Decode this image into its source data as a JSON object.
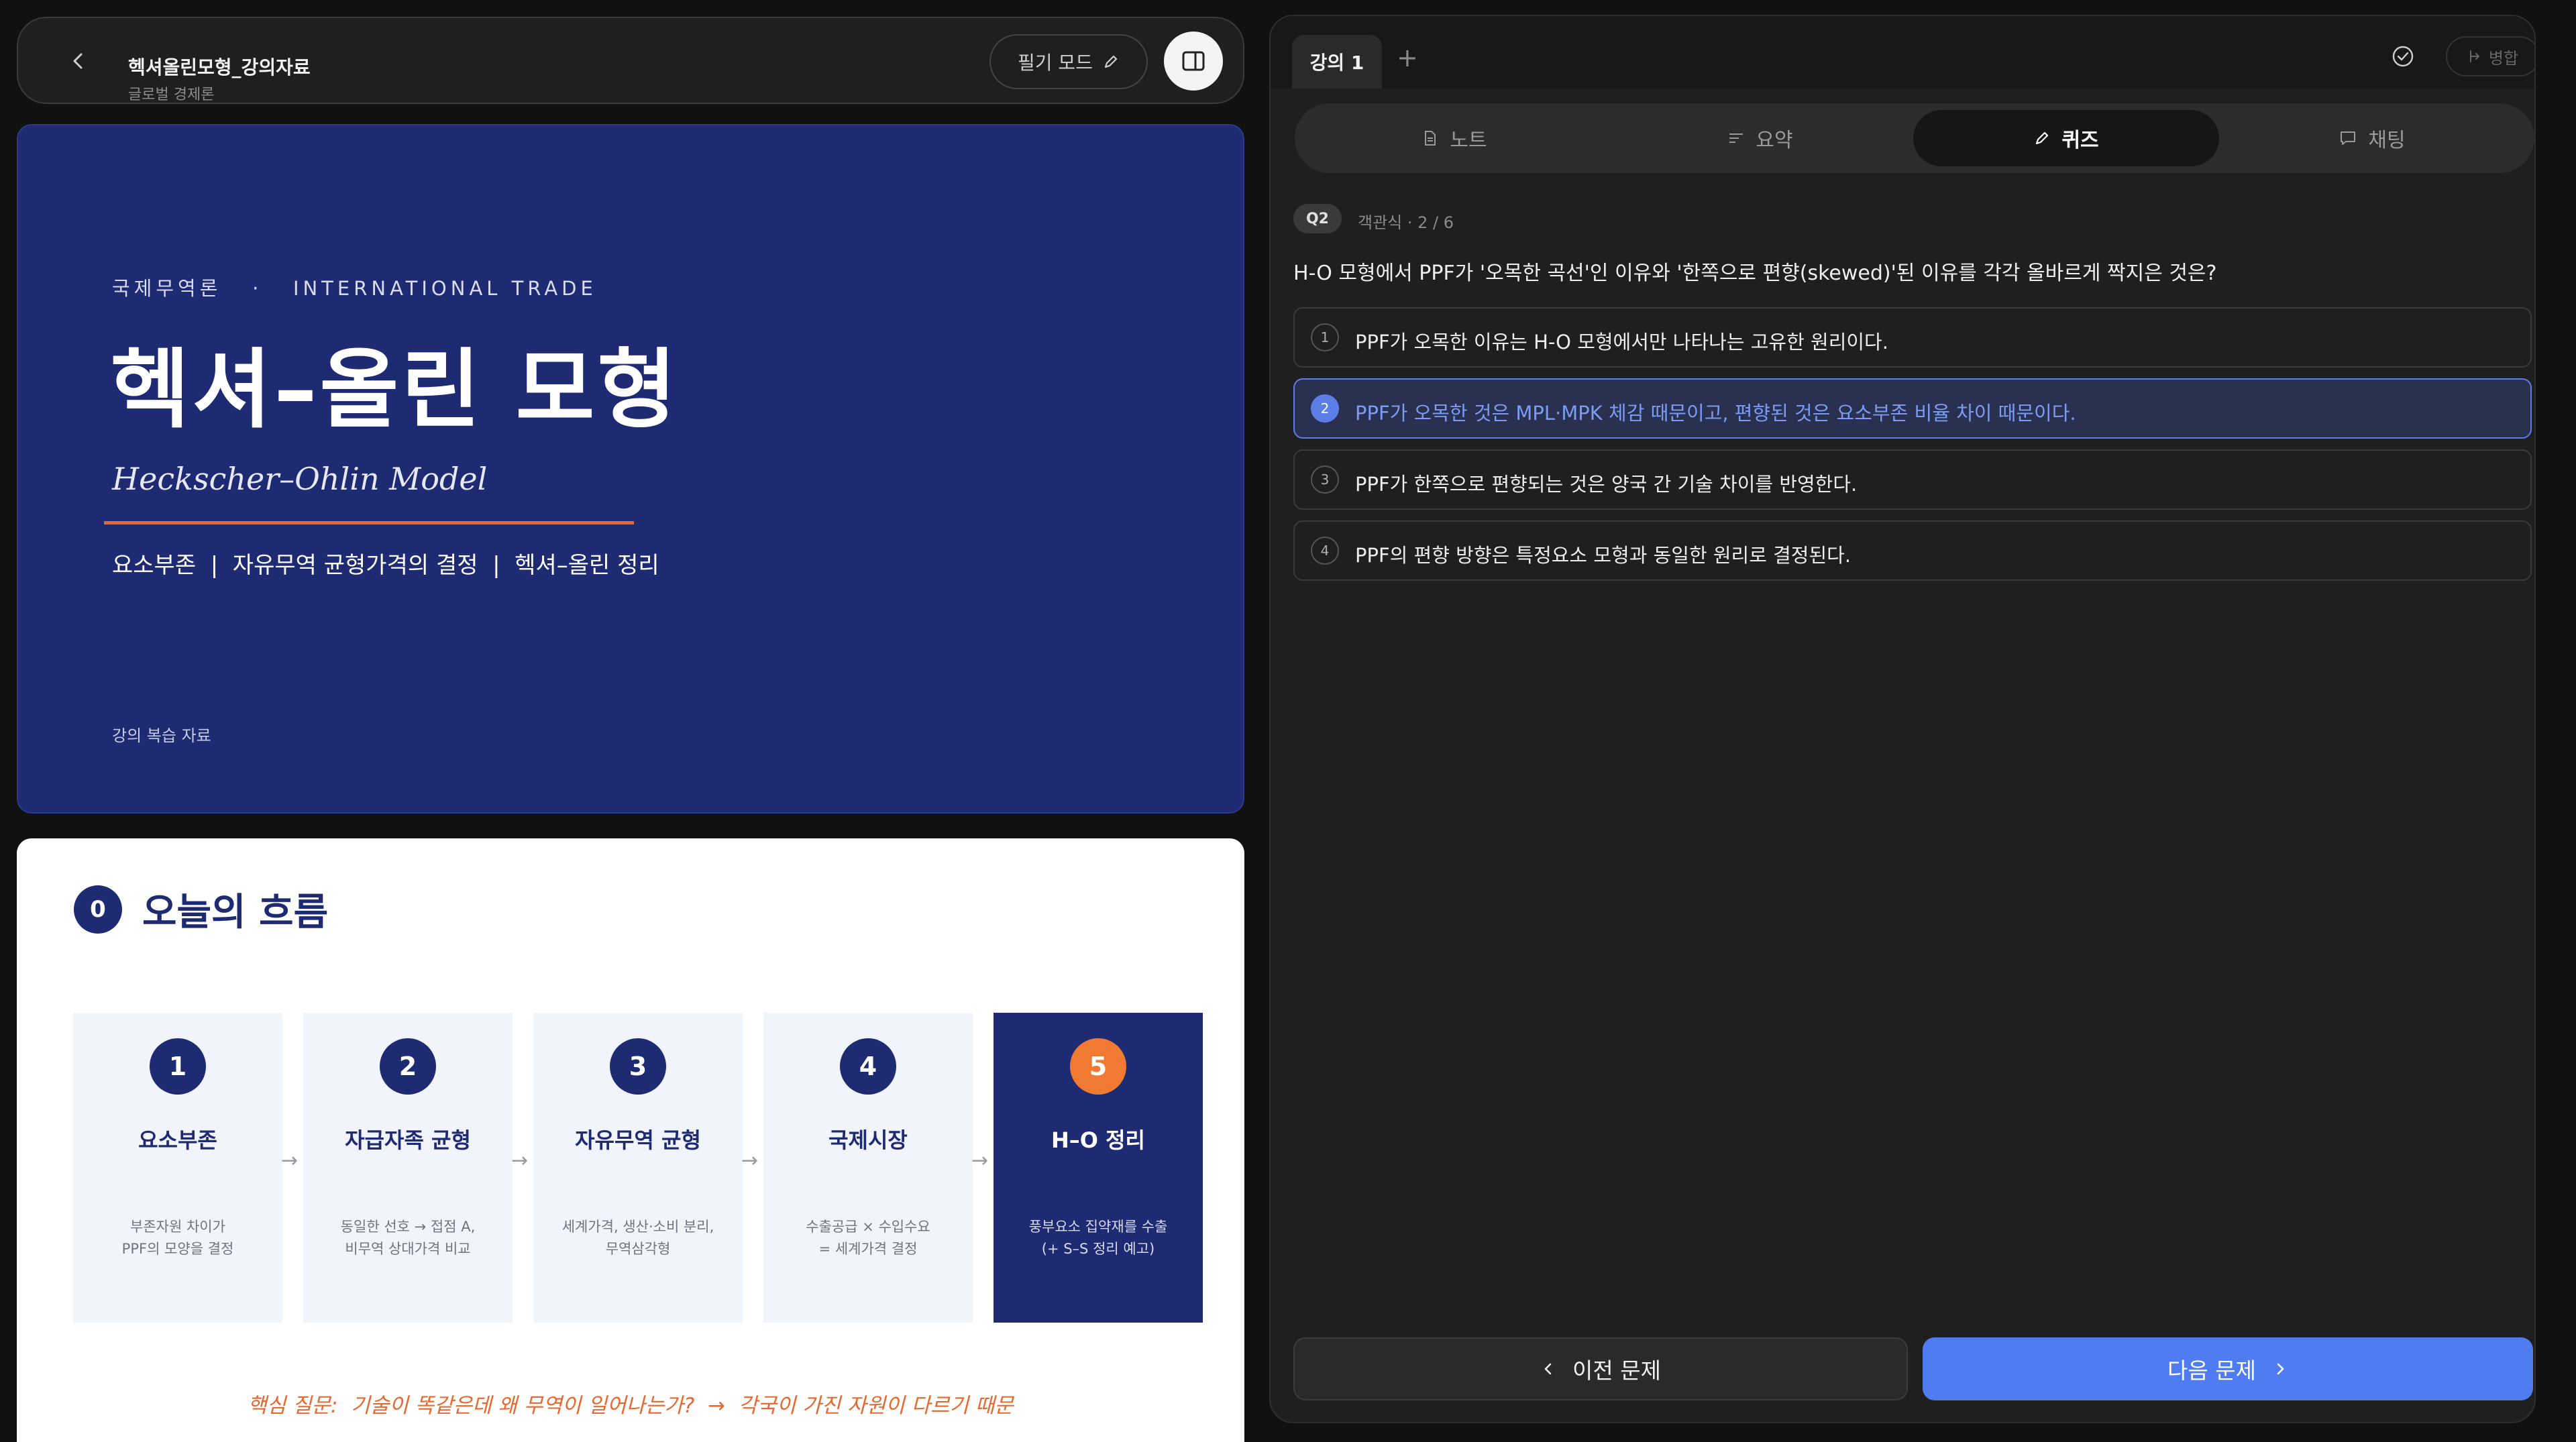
{
  "header": {
    "title": "헥셔올린모형_강의자료",
    "subtitle": "글로벌 경제론",
    "pen_mode_label": "필기 모드"
  },
  "title_slide": {
    "kicker_ko": "국제무역론",
    "kicker_sep": "·",
    "kicker_en": "INTERNATIONAL TRADE",
    "title": "헥셔–올린 모형",
    "english_title": "Heckscher–Ohlin Model",
    "topics": "요소부존  |  자유무역 균형가격의 결정  |  헥셔–올린 정리",
    "footer": "강의 복습 자료"
  },
  "flow_slide": {
    "section_number": "0",
    "title": "오늘의 흐름",
    "steps": [
      {
        "num": "1",
        "title": "요소부존",
        "desc1": "부존자원 차이가",
        "desc2": "PPF의 모양을 결정"
      },
      {
        "num": "2",
        "title": "자급자족 균형",
        "desc1": "동일한 선호 → 접점 A,",
        "desc2": "비무역 상대가격 비교"
      },
      {
        "num": "3",
        "title": "자유무역 균형",
        "desc1": "세계가격, 생산·소비 분리,",
        "desc2": "무역삼각형"
      },
      {
        "num": "4",
        "title": "국제시장",
        "desc1": "수출공급 × 수입수요",
        "desc2": "= 세계가격 결정"
      },
      {
        "num": "5",
        "title": "H–O 정리",
        "desc1": "풍부요소 집약재를 수출",
        "desc2": "(+ S–S 정리 예고)"
      }
    ],
    "arrow": "→",
    "key_question": "핵심 질문:  기술이 똑같은데 왜 무역이 일어나는가?  →  각국이 가진 자원이 다르기 때문"
  },
  "right_panel": {
    "tab_label": "강의 1",
    "add_tab": "+",
    "merge_label": "병합",
    "segments": [
      {
        "label": "노트",
        "icon": "document-icon"
      },
      {
        "label": "요약",
        "icon": "lines-icon"
      },
      {
        "label": "퀴즈",
        "icon": "pencil-icon"
      },
      {
        "label": "채팅",
        "icon": "chat-icon"
      }
    ],
    "active_segment": "퀴즈",
    "quiz": {
      "tag": "Q2",
      "meta": "객관식 · 2 / 6",
      "question": "H-O 모형에서 PPF가 '오목한 곡선'인 이유와 '한쪽으로 편향(skewed)'된 이유를 각각 올바르게 짝지은 것은?",
      "options": [
        {
          "num": "1",
          "text": "PPF가 오목한 이유는 H-O 모형에서만 나타나는 고유한 원리이다."
        },
        {
          "num": "2",
          "text": "PPF가 오목한 것은 MPL·MPK 체감 때문이고, 편향된 것은 요소부존 비율 차이 때문이다."
        },
        {
          "num": "3",
          "text": "PPF가 한쪽으로 편향되는 것은 양국 간 기술 차이를 반영한다."
        },
        {
          "num": "4",
          "text": "PPF의 편향 방향은 특정요소 모형과 동일한 원리로 결정된다."
        }
      ],
      "selected_option": "2",
      "prev_label": "이전 문제",
      "next_label": "다음 문제"
    }
  },
  "colors": {
    "slide_navy": "#1e2a72",
    "accent_orange": "#e8672f",
    "selected_blue": "#5b7fe6",
    "next_button": "#4f7cf0"
  }
}
